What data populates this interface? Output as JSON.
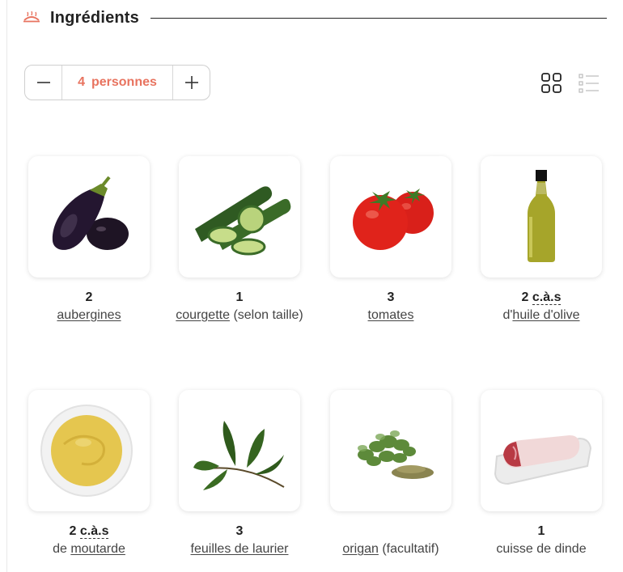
{
  "header": {
    "title": "Ingrédients",
    "icon": "dish-icon"
  },
  "servings": {
    "count": "4",
    "label": "personnes",
    "minus_icon": "minus-icon",
    "plus_icon": "plus-icon"
  },
  "view": {
    "grid_icon": "grid-view-icon",
    "list_icon": "list-view-icon",
    "active": "grid"
  },
  "colors": {
    "accent": "#e8735f",
    "text": "#333333",
    "border": "#cfcfcf"
  },
  "ingredients": [
    {
      "qty": "2",
      "unit": "",
      "prefix": "",
      "link": "aubergines",
      "suffix": "",
      "icon": "eggplant-icon"
    },
    {
      "qty": "1",
      "unit": "",
      "prefix": "",
      "link": "courgette",
      "suffix": " (selon taille)",
      "icon": "zucchini-icon"
    },
    {
      "qty": "3",
      "unit": "",
      "prefix": "",
      "link": "tomates",
      "suffix": "",
      "icon": "tomato-icon"
    },
    {
      "qty": "2",
      "unit": "c.à.s",
      "prefix": "d'",
      "link": "huile d'olive",
      "suffix": "",
      "icon": "olive-oil-bottle-icon"
    },
    {
      "qty": "2",
      "unit": "c.à.s",
      "prefix": "de ",
      "link": "moutarde",
      "suffix": "",
      "icon": "mustard-bowl-icon"
    },
    {
      "qty": "3",
      "unit": "",
      "prefix": "",
      "link": "feuilles de laurier",
      "suffix": "",
      "icon": "bay-leaf-icon"
    },
    {
      "qty": "",
      "unit": "",
      "prefix": "",
      "link": "origan",
      "suffix": " (facultatif)",
      "icon": "oregano-icon"
    },
    {
      "qty": "1",
      "unit": "",
      "prefix": "cuisse de dinde",
      "link": "",
      "suffix": "",
      "icon": "turkey-leg-icon"
    }
  ]
}
